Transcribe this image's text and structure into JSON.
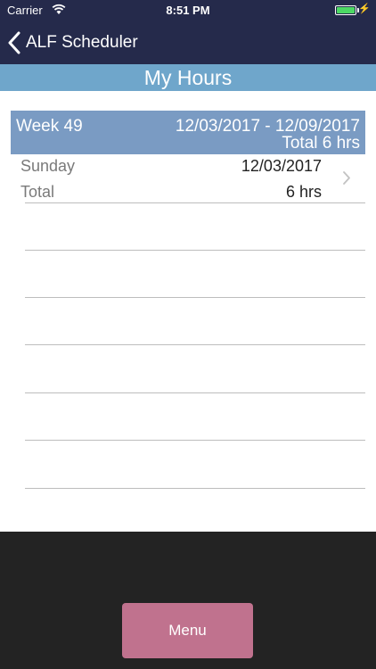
{
  "status_bar": {
    "carrier": "Carrier",
    "time": "8:51 PM",
    "wifi_icon": "wifi-icon",
    "battery_icon": "battery-icon",
    "battery_level": 1.0,
    "charging_icon": "bolt-icon"
  },
  "nav": {
    "back_label": "ALF Scheduler",
    "back_icon": "chevron-left-icon"
  },
  "page": {
    "title": "My Hours"
  },
  "week": {
    "label": "Week 49",
    "range": "12/03/2017 - 12/09/2017",
    "total": "Total 6 hrs"
  },
  "days": [
    {
      "day": "Sunday",
      "date": "12/03/2017",
      "total_label": "Total",
      "total_value": "6 hrs"
    }
  ],
  "bottom": {
    "menu_label": "Menu"
  },
  "colors": {
    "nav_background": "#252a4b",
    "title_band": "#6fa6cb",
    "week_header": "#7a9bc3",
    "menu_button": "#c0728e",
    "footer_background": "#232323",
    "battery_fill": "#4cd964"
  }
}
